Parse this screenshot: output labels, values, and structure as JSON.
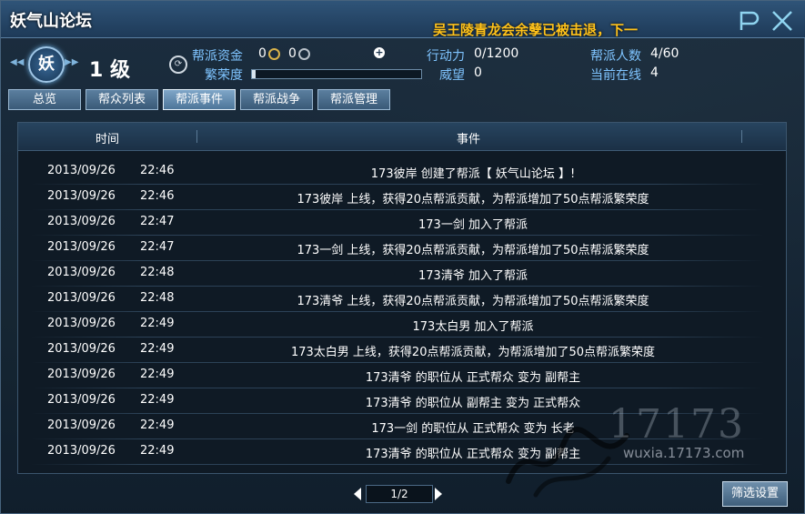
{
  "window": {
    "title": "妖气山论坛",
    "notice": "吴王陵青龙会余孽已被击退，下一"
  },
  "guild": {
    "emblem": "妖",
    "level": "1 级",
    "funds_label": "帮派资金",
    "funds_gold": "0",
    "funds_silver": "0",
    "prosperity_label": "繁荣度",
    "prosperity_fraction": 0.0,
    "action_label": "行动力",
    "action_value": "0/1200",
    "prestige_label": "威望",
    "prestige_value": "0",
    "members_label": "帮派人数",
    "members_value": "4/60",
    "online_label": "当前在线",
    "online_value": "4"
  },
  "tabs": [
    {
      "label": "总览",
      "active": false
    },
    {
      "label": "帮众列表",
      "active": false
    },
    {
      "label": "帮派事件",
      "active": true
    },
    {
      "label": "帮派战争",
      "active": false
    },
    {
      "label": "帮派管理",
      "active": false
    }
  ],
  "table": {
    "col_time": "时间",
    "col_event": "事件",
    "rows": [
      {
        "date": "2013/09/26",
        "time": "22:46",
        "event": "173彼岸 创建了帮派【 妖气山论坛 】!"
      },
      {
        "date": "2013/09/26",
        "time": "22:46",
        "event": "173彼岸 上线，获得20点帮派贡献，为帮派增加了50点帮派繁荣度"
      },
      {
        "date": "2013/09/26",
        "time": "22:47",
        "event": "173一剑 加入了帮派"
      },
      {
        "date": "2013/09/26",
        "time": "22:47",
        "event": "173一剑 上线，获得20点帮派贡献，为帮派增加了50点帮派繁荣度"
      },
      {
        "date": "2013/09/26",
        "time": "22:48",
        "event": "173清爷 加入了帮派"
      },
      {
        "date": "2013/09/26",
        "time": "22:48",
        "event": "173清爷 上线，获得20点帮派贡献，为帮派增加了50点帮派繁荣度"
      },
      {
        "date": "2013/09/26",
        "time": "22:49",
        "event": "173太白男 加入了帮派"
      },
      {
        "date": "2013/09/26",
        "time": "22:49",
        "event": "173太白男 上线，获得20点帮派贡献，为帮派增加了50点帮派繁荣度"
      },
      {
        "date": "2013/09/26",
        "time": "22:49",
        "event": "173清爷 的职位从 正式帮众 变为 副帮主"
      },
      {
        "date": "2013/09/26",
        "time": "22:49",
        "event": "173清爷 的职位从 副帮主 变为 正式帮众"
      },
      {
        "date": "2013/09/26",
        "time": "22:49",
        "event": "173一剑 的职位从 正式帮众 变为 长老"
      },
      {
        "date": "2013/09/26",
        "time": "22:49",
        "event": "173清爷 的职位从 正式帮众 变为 副帮主"
      }
    ]
  },
  "pager": {
    "page": "1/2"
  },
  "filter_button": "筛选设置",
  "watermark": {
    "number": "17173",
    "url": "wuxia.17173.com"
  }
}
